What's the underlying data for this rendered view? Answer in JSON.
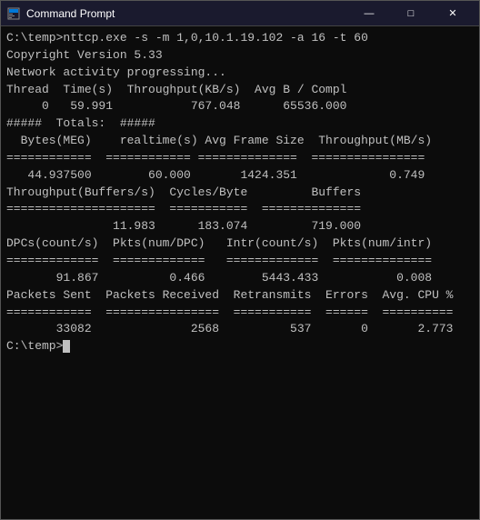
{
  "titleBar": {
    "title": "Command Prompt",
    "minimize": "—",
    "maximize": "□",
    "close": "✕"
  },
  "console": {
    "lines": [
      "C:\\temp>nttcp.exe -s -m 1,0,10.1.19.102 -a 16 -t 60",
      "Copyright Version 5.33",
      "Network activity progressing...",
      "",
      "Thread  Time(s)  Throughput(KB/s)  Avg B / Compl",
      "",
      "     0   59.991           767.048      65536.000",
      "",
      "",
      "#####  Totals:  #####",
      "",
      "",
      "  Bytes(MEG)    realtime(s) Avg Frame Size  Throughput(MB/s)",
      "============  ============ ==============  ================",
      "   44.937500        60.000       1424.351             0.749",
      "",
      "",
      "Throughput(Buffers/s)  Cycles/Byte         Buffers",
      "=====================  ===========  ==============",
      "               11.983      183.074         719.000",
      "",
      "",
      "DPCs(count/s)  Pkts(num/DPC)   Intr(count/s)  Pkts(num/intr)",
      "=============  =============   =============  ==============",
      "       91.867          0.466        5443.433           0.008",
      "",
      "",
      "Packets Sent  Packets Received  Retransmits  Errors  Avg. CPU %",
      "============  ================  ===========  ======  ==========",
      "       33082              2568          537       0       2.773",
      "",
      "C:\\temp>"
    ]
  }
}
